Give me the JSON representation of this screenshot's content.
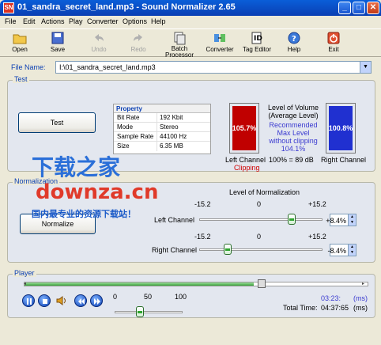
{
  "window": {
    "title": "01_sandra_secret_land.mp3 - Sound Normalizer 2.65",
    "icon_text": "SN",
    "controls": [
      "minimize",
      "maximize",
      "close"
    ]
  },
  "menu": [
    "File",
    "Edit",
    "Actions",
    "Play",
    "Converter",
    "Options",
    "Help"
  ],
  "toolbar": {
    "open": "Open",
    "save": "Save",
    "undo": "Undo",
    "redo": "Redo",
    "batch": "Batch\nProcessor",
    "converter": "Converter",
    "tag_editor": "Tag Editor",
    "help": "Help",
    "exit": "Exit"
  },
  "file": {
    "label": "File Name:",
    "value": "I:\\01_sandra_secret_land.mp3"
  },
  "test": {
    "title": "Test",
    "button": "Test",
    "property_header": "Property",
    "properties": [
      {
        "key": "Bit Rate",
        "value": "192 Kbit"
      },
      {
        "key": "Mode",
        "value": "Stereo"
      },
      {
        "key": "Sample Rate",
        "value": "44100 Hz"
      },
      {
        "key": "Size",
        "value": "6.35 MB"
      }
    ],
    "left_meter": {
      "value": "105.7%",
      "label": "Left Channel",
      "status": "Clipping",
      "color": "#c00000"
    },
    "right_meter": {
      "value": "100.8%",
      "label": "Right Channel",
      "color": "#2030d0"
    },
    "level_title": "Level of Volume\n(Average Level)",
    "recommended": "Recommended\nMax Level\nwithout clipping\n104.1%",
    "db_note": "100% = 89 dB"
  },
  "normalization": {
    "title": "Normalization",
    "button": "Normalize",
    "level_title": "Level of Normalization",
    "scale": {
      "min": "-15.2",
      "mid": "0",
      "max": "+15.2"
    },
    "left": {
      "label": "Left Channel",
      "value": "+8.4%"
    },
    "right": {
      "label": "Right Channel",
      "value": "-8.4%"
    }
  },
  "player": {
    "title": "Player",
    "volume_scale": {
      "min": "0",
      "mid": "50",
      "max": "100"
    },
    "time_current": "03:23:",
    "time_unit": "(ms)",
    "total_label": "Total Time:",
    "total_value": "04:37:65",
    "total_unit": "(ms)"
  },
  "watermark": {
    "line1": "下载之家",
    "line2": "downza.cn",
    "line3": "国内最专业的资源下载站！"
  }
}
